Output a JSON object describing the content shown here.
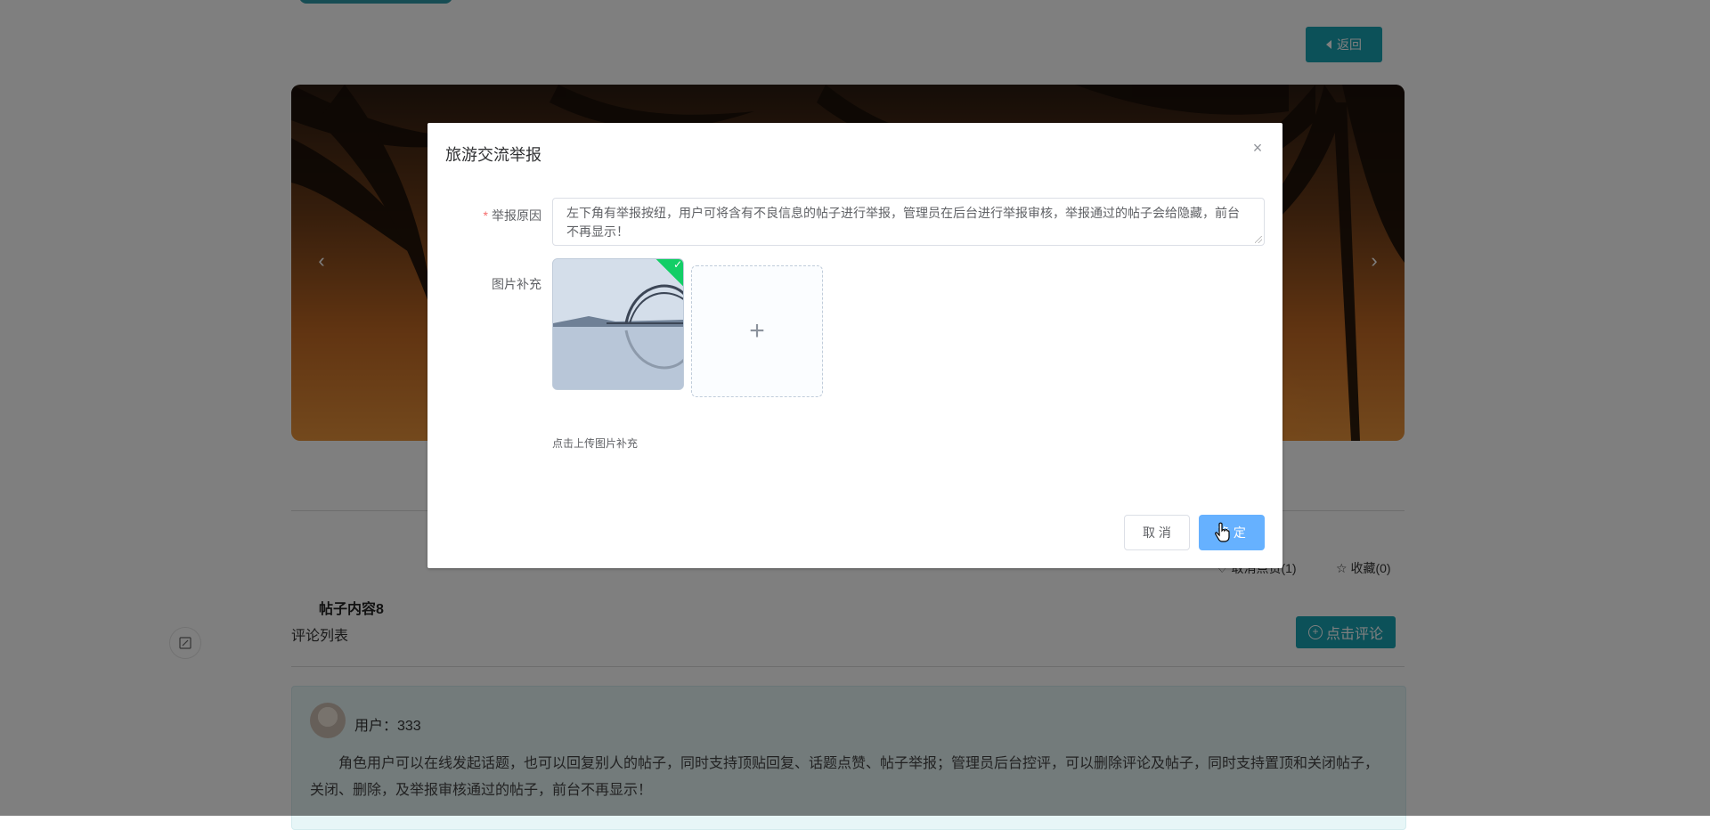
{
  "page": {
    "back_label": "返回",
    "banner_prev": "‹",
    "banner_next": "›",
    "like_label": "取消点赞(1)",
    "favorite_label": "收藏(0)",
    "post_title": "帖子内容8",
    "comment_list_label": "评论列表",
    "comment_button_label": "点击评论",
    "comment": {
      "user": "用户：333",
      "text": "角色用户可以在线发起话题，也可以回复别人的帖子，同时支持顶贴回复、话题点赞、帖子举报；管理员后台控评，可以删除评论及帖子，同时支持置顶和关闭帖子，关闭、删除，及举报审核通过的帖子，前台不再显示！"
    }
  },
  "dialog": {
    "title": "旅游交流举报",
    "close_icon": "×",
    "reason_label": "举报原因",
    "required_mark": "*",
    "reason_value": "左下角有举报按纽，用户可将含有不良信息的帖子进行举报，管理员在后台进行举报审核，举报通过的帖子会给隐藏，前台不再显示！",
    "image_label": "图片补充",
    "upload_plus": "+",
    "upload_hint": "点击上传图片补充",
    "success_mark": "✓",
    "cancel_label": "取 消",
    "ok_label": "确 定"
  },
  "colors": {
    "primary_teal": "#19a3b3",
    "ok_button": "#66b1ff",
    "success": "#13ce66",
    "required": "#f56c6c"
  }
}
